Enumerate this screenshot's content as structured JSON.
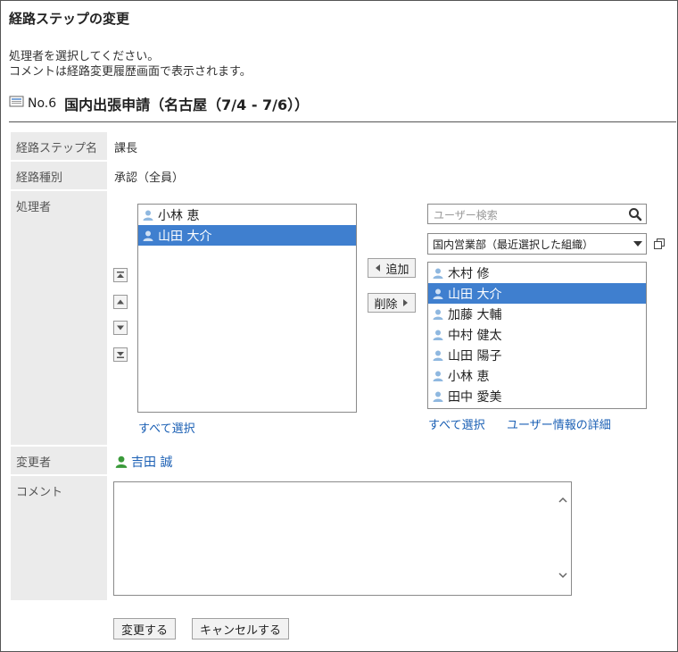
{
  "page": {
    "title": "経路ステップの変更",
    "desc_line1": "処理者を選択してください。",
    "desc_line2": "コメントは経路変更履歴画面で表示されます。"
  },
  "application": {
    "number": "No.6",
    "name": "国内出張申請（名古屋（7/4 - 7/6））"
  },
  "form": {
    "step_name_label": "経路ステップ名",
    "step_name_value": "課長",
    "route_type_label": "経路種別",
    "route_type_value": "承認（全員）",
    "processor_label": "処理者",
    "changer_label": "変更者",
    "changer_name": "吉田 誠",
    "comment_label": "コメント"
  },
  "selected_list": {
    "items": [
      {
        "name": "小林 恵",
        "selected": false
      },
      {
        "name": "山田 大介",
        "selected": true
      }
    ],
    "select_all": "すべて選択"
  },
  "buttons": {
    "add": "追加",
    "remove": "削除",
    "submit": "変更する",
    "cancel": "キャンセルする"
  },
  "candidate": {
    "search_placeholder": "ユーザー検索",
    "org_select": "国内営業部（最近選択した組織）",
    "items": [
      {
        "name": "木村 修",
        "selected": false
      },
      {
        "name": "山田 大介",
        "selected": true
      },
      {
        "name": "加藤 大輔",
        "selected": false
      },
      {
        "name": "中村 健太",
        "selected": false
      },
      {
        "name": "山田 陽子",
        "selected": false
      },
      {
        "name": "小林 恵",
        "selected": false
      },
      {
        "name": "田中 愛美",
        "selected": false
      }
    ],
    "select_all": "すべて選択",
    "user_details": "ユーザー情報の詳細"
  },
  "colors": {
    "selection": "#3f7fcf",
    "link": "#1a5fb4",
    "label_bg": "#ebebeb",
    "user_icon": "#8fb8e0",
    "changer_icon": "#3a9a3a"
  }
}
